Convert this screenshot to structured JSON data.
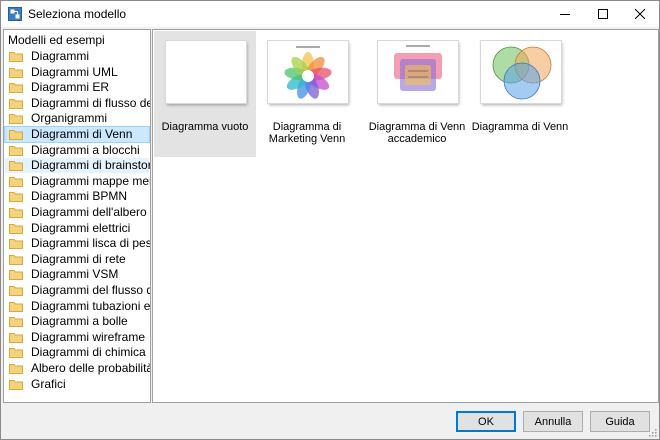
{
  "window": {
    "title": "Seleziona modello"
  },
  "sidebar": {
    "header": "Modelli ed esempi",
    "items": [
      {
        "label": "Diagrammi"
      },
      {
        "label": "Diagrammi UML"
      },
      {
        "label": "Diagrammi ER"
      },
      {
        "label": "Diagrammi di flusso dei ..."
      },
      {
        "label": "Organigrammi"
      },
      {
        "label": "Diagrammi di Venn"
      },
      {
        "label": "Diagrammi a blocchi"
      },
      {
        "label": "Diagrammi di brainstor..."
      },
      {
        "label": "Diagrammi mappe mentali"
      },
      {
        "label": "Diagrammi BPMN"
      },
      {
        "label": "Diagrammi dell'albero g..."
      },
      {
        "label": "Diagrammi elettrici"
      },
      {
        "label": "Diagrammi lisca di pesce"
      },
      {
        "label": "Diagrammi di rete"
      },
      {
        "label": "Diagrammi VSM"
      },
      {
        "label": "Diagrammi del flusso di ..."
      },
      {
        "label": "Diagrammi tubazioni e s..."
      },
      {
        "label": "Diagrammi a bolle"
      },
      {
        "label": "Diagrammi wireframe"
      },
      {
        "label": "Diagrammi di chimica"
      },
      {
        "label": "Albero delle probabilità"
      },
      {
        "label": "Grafici"
      }
    ],
    "selected": "Diagrammi di Venn",
    "hovered": "Diagrammi di brainstor..."
  },
  "templates": [
    {
      "caption": "Diagramma vuoto"
    },
    {
      "caption": "Diagramma di Marketing Venn"
    },
    {
      "caption": "Diagramma di Venn accademico"
    },
    {
      "caption": "Diagramma di Venn"
    }
  ],
  "buttons": {
    "ok": "OK",
    "cancel": "Annulla",
    "help": "Guida"
  }
}
